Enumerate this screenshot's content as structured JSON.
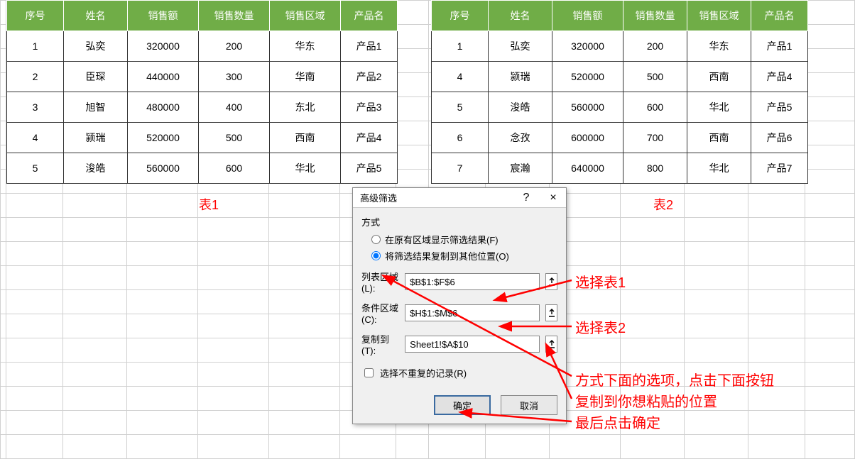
{
  "headers": [
    "序号",
    "姓名",
    "销售额",
    "销售数量",
    "销售区域",
    "产品名"
  ],
  "table1": {
    "label": "表1",
    "rows": [
      [
        "1",
        "弘奕",
        "320000",
        "200",
        "华东",
        "产品1"
      ],
      [
        "2",
        "臣琛",
        "440000",
        "300",
        "华南",
        "产品2"
      ],
      [
        "3",
        "旭智",
        "480000",
        "400",
        "东北",
        "产品3"
      ],
      [
        "4",
        "颍瑞",
        "520000",
        "500",
        "西南",
        "产品4"
      ],
      [
        "5",
        "浚皓",
        "560000",
        "600",
        "华北",
        "产品5"
      ]
    ]
  },
  "table2": {
    "label": "表2",
    "rows": [
      [
        "1",
        "弘奕",
        "320000",
        "200",
        "华东",
        "产品1"
      ],
      [
        "4",
        "颍瑞",
        "520000",
        "500",
        "西南",
        "产品4"
      ],
      [
        "5",
        "浚皓",
        "560000",
        "600",
        "华北",
        "产品5"
      ],
      [
        "6",
        "念孜",
        "600000",
        "700",
        "西南",
        "产品6"
      ],
      [
        "7",
        "宸瀚",
        "640000",
        "800",
        "华北",
        "产品7"
      ]
    ]
  },
  "dialog": {
    "title": "高级筛选",
    "help": "?",
    "close": "×",
    "method_label": "方式",
    "radio1": "在原有区域显示筛选结果(F)",
    "radio2": "将筛选结果复制到其他位置(O)",
    "list_label": "列表区域(L):",
    "cond_label": "条件区域(C):",
    "copy_label": "复制到(T):",
    "list_val": "$B$1:$F$6",
    "cond_val": "$H$1:$M$6",
    "copy_val": "Sheet1!$A$10",
    "unique_label": "选择不重复的记录(R)",
    "ok": "确定",
    "cancel": "取消"
  },
  "annotations": {
    "sel1": "选择表1",
    "sel2": "选择表2",
    "desc": "方式下面的选项，点击下面按钮\n复制到你想粘贴的位置\n最后点击确定"
  }
}
